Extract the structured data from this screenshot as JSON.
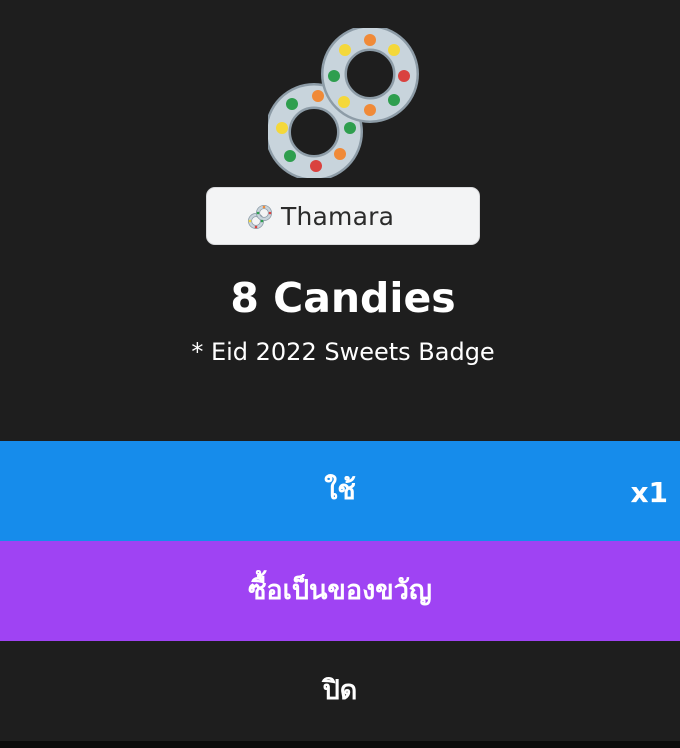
{
  "badge": {
    "owner_name": "Thamara",
    "title": "8 Candies",
    "subtitle": "* Eid 2022 Sweets Badge",
    "image_icon": "candy-figure-eight-icon",
    "chip_icon": "candy-figure-eight-icon"
  },
  "actions": {
    "use_label": "ใช้",
    "use_count": "x1",
    "gift_label": "ซื้อเป็นของขวัญ",
    "close_label": "ปิด"
  },
  "colors": {
    "background": "#1e1e1e",
    "use_button": "#168ceb",
    "gift_button": "#9f43f3",
    "chip_background": "#f3f4f5"
  }
}
